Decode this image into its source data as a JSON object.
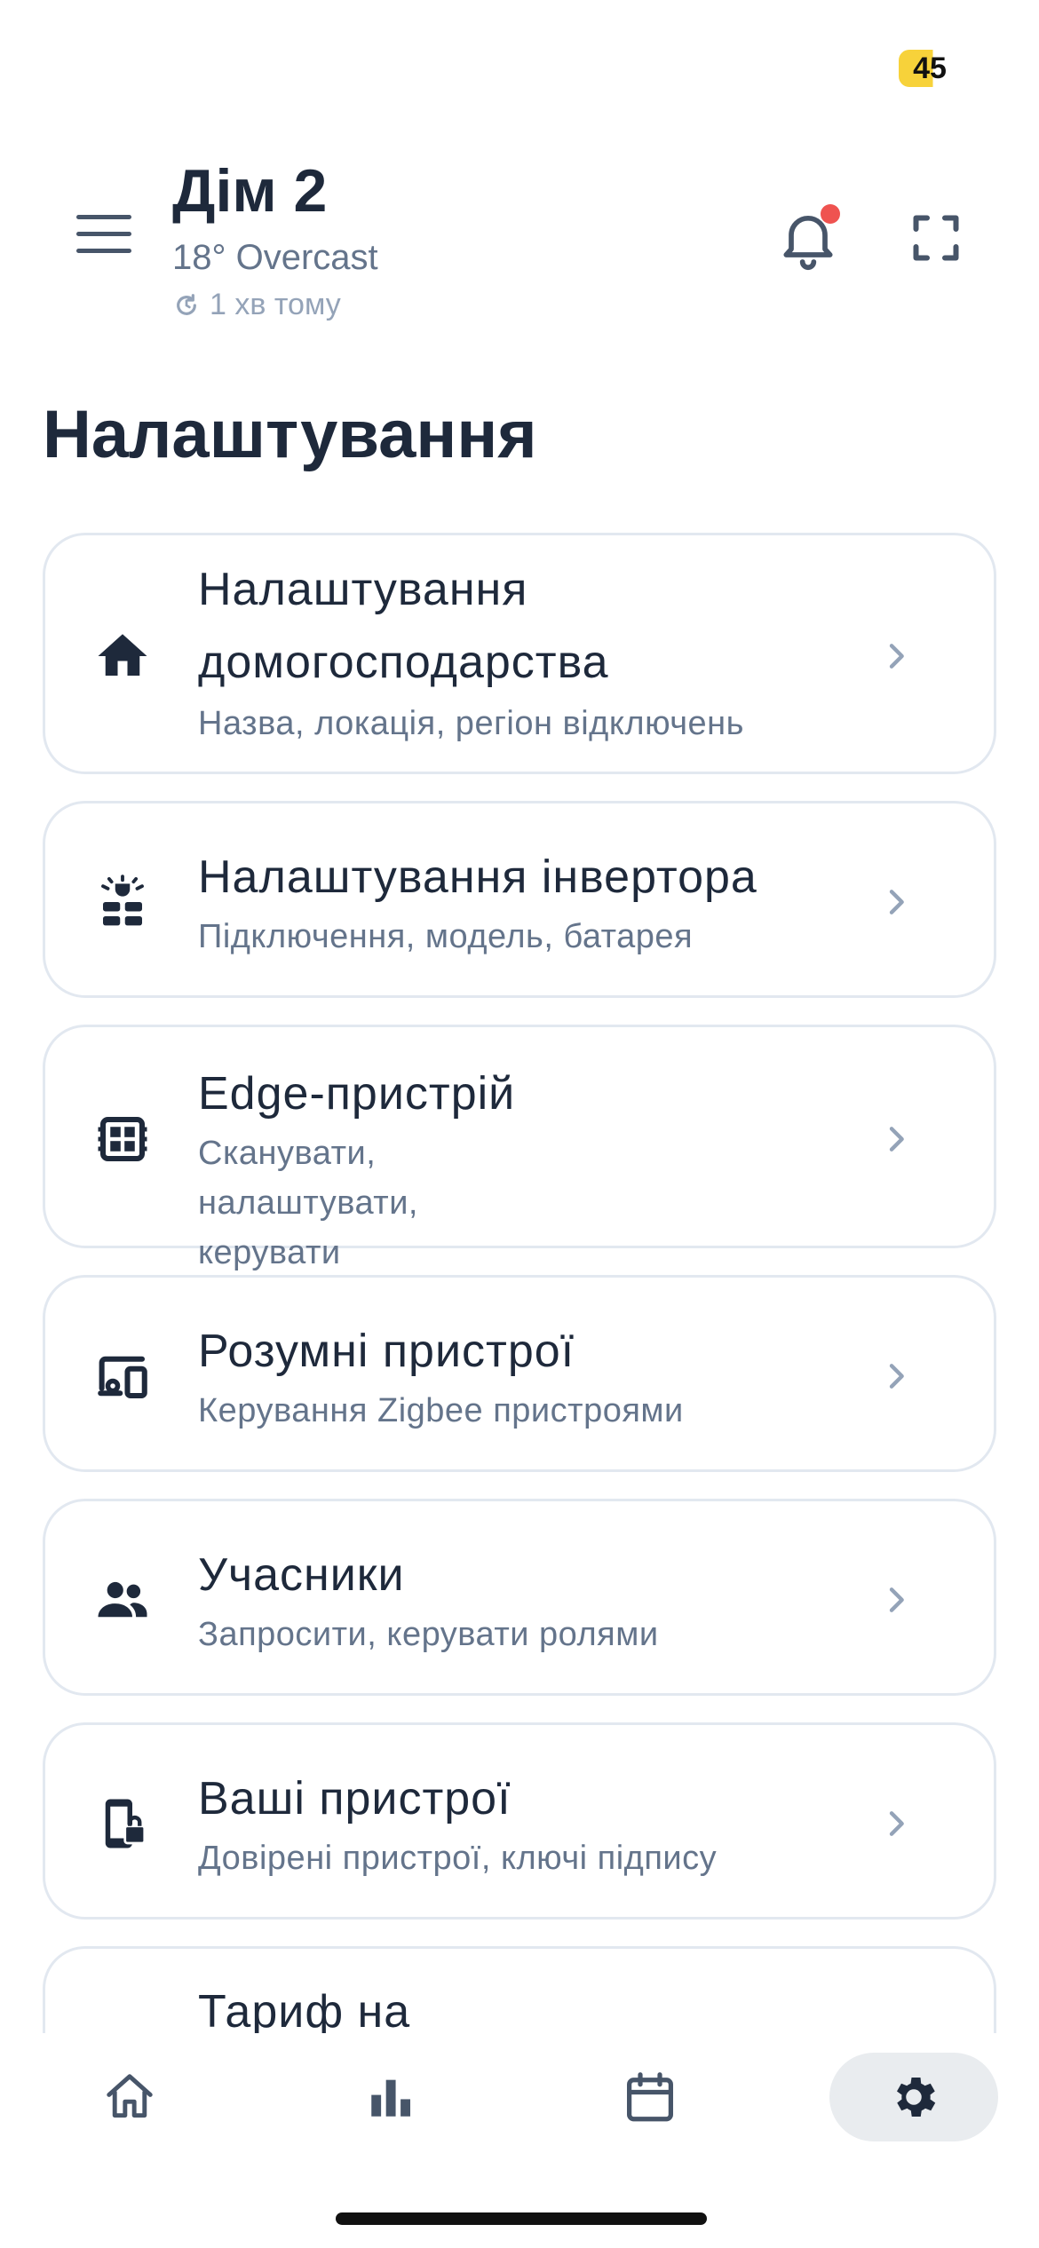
{
  "status_bar": {
    "battery": "45"
  },
  "header": {
    "home_name": "Дім 2",
    "weather": "18° Overcast",
    "updated": "1 хв тому"
  },
  "page": {
    "title": "Налаштування"
  },
  "settings_items": [
    {
      "icon": "home-icon",
      "title": "Налаштування домогосподарства",
      "subtitle": "Назва, локація, регіон відключень"
    },
    {
      "icon": "inverter-icon",
      "title": "Налаштування інвертора",
      "subtitle": "Підключення, модель, батарея"
    },
    {
      "icon": "edge-device-icon",
      "title": "Edge-пристрій",
      "subtitle": "Сканувати, налаштувати, керувати"
    },
    {
      "icon": "smart-devices-icon",
      "title": "Розумні пристрої",
      "subtitle": "Керування Zigbee пристроями"
    },
    {
      "icon": "members-icon",
      "title": "Учасники",
      "subtitle": "Запросити, керувати ролями"
    },
    {
      "icon": "phone-lock-icon",
      "title": "Ваші пристрої",
      "subtitle": "Довірені пристрої, ключі підпису"
    },
    {
      "icon": "",
      "title": "Тариф на",
      "subtitle": ""
    }
  ],
  "bottom_nav": [
    {
      "icon": "home-outline-icon",
      "active": false
    },
    {
      "icon": "bar-chart-icon",
      "active": false
    },
    {
      "icon": "calendar-icon",
      "active": false
    },
    {
      "icon": "gear-icon",
      "active": true
    }
  ],
  "colors": {
    "text_primary": "#1e293b",
    "text_secondary": "#64748b",
    "text_muted": "#94a3b8",
    "card_border": "#e2e8f0",
    "notification_dot": "#ef5350",
    "battery_yellow": "#f7d23a",
    "nav_active_bg": "#e9ecef"
  }
}
